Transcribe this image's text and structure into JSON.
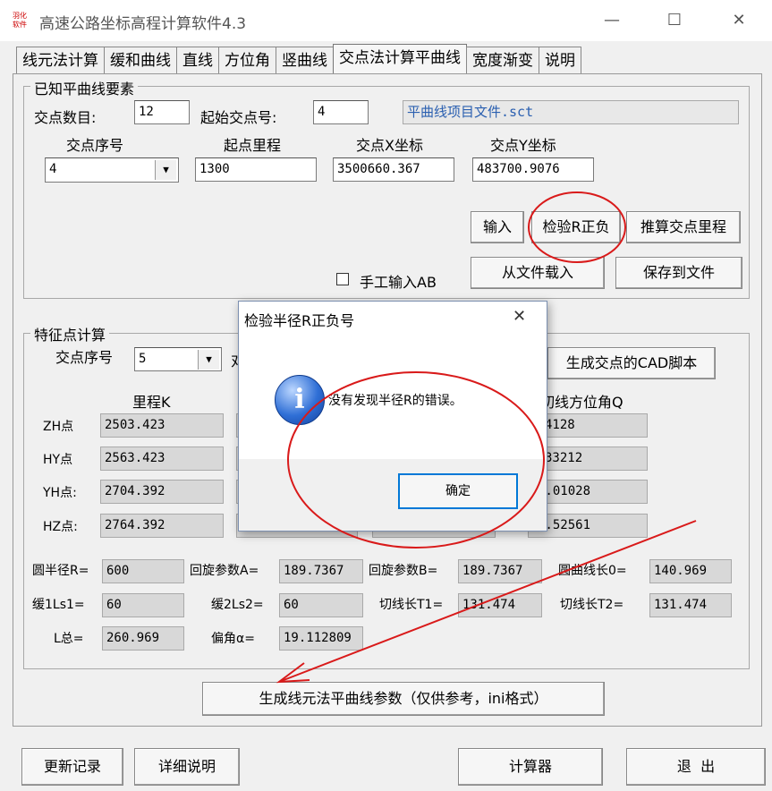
{
  "window": {
    "title": "高速公路坐标高程计算软件4.3",
    "icon_text": "羽化\n软件",
    "minimize_icon": "—",
    "maximize_icon": "☐",
    "close_icon": "✕"
  },
  "tabs": [
    {
      "label": "线元法计算",
      "active": false
    },
    {
      "label": "缓和曲线",
      "active": false
    },
    {
      "label": "直线",
      "active": false
    },
    {
      "label": "方位角",
      "active": false
    },
    {
      "label": "竖曲线",
      "active": false
    },
    {
      "label": "交点法计算平曲线",
      "active": true
    },
    {
      "label": "宽度渐变",
      "active": false
    },
    {
      "label": "说明",
      "active": false
    }
  ],
  "known": {
    "legend": "已知平曲线要素",
    "count_label": "交点数目:",
    "count_value": "12",
    "start_label": "起始交点号:",
    "start_value": "4",
    "file_name": "平曲线项目文件.sct",
    "col_index": "交点序号",
    "col_start_mileage": "起点里程",
    "col_x": "交点X坐标",
    "col_y": "交点Y坐标",
    "index_value": "4",
    "start_mileage_value": "1300",
    "x_value": "3500660.367",
    "y_value": "483700.9076",
    "btn_input": "输入",
    "btn_check_r": "检验R正负",
    "btn_calc_mileage": "推算交点里程",
    "manual_ab_label": "手工输入AB",
    "btn_load": "从文件载入",
    "btn_save": "保存到文件"
  },
  "feature": {
    "legend": "特征点计算",
    "index_label": "交点序号",
    "index_value": "5",
    "partial_label": "对",
    "btn_cad": "生成交点的CAD脚本",
    "col_mileage": "里程K",
    "col_azimuth": "切线方位角Q",
    "rows": [
      {
        "label": "ZH点",
        "mileage": "2503.423",
        "azimuth": "4128"
      },
      {
        "label": "HY点",
        "mileage": "2563.423",
        "azimuth": "33212"
      },
      {
        "label": "YH点:",
        "mileage": "2704.392",
        "azimuth": "4.01028"
      },
      {
        "label": "HZ点:",
        "mileage": "2764.392",
        "azimuth": "6.52561"
      }
    ],
    "params": {
      "radius_label": "圆半径R=",
      "radius_value": "600",
      "a_label": "回旋参数A=",
      "a_value": "189.7367",
      "b_label": "回旋参数B=",
      "b_value": "189.7367",
      "lo_label": "圆曲线长0=",
      "lo_value": "140.969",
      "ls1_label": "缓1Ls1=",
      "ls1_value": "60",
      "ls2_label": "缓2Ls2=",
      "ls2_value": "60",
      "t1_label": "切线长T1=",
      "t1_value": "131.474",
      "t2_label": "切线长T2=",
      "t2_value": "131.474",
      "ltotal_label": "L总=",
      "ltotal_value": "260.969",
      "alpha_label": "偏角α=",
      "alpha_value": "19.112809"
    },
    "btn_generate": "生成线元法平曲线参数（仅供参考，ini格式）"
  },
  "bottom": {
    "btn_log": "更新记录",
    "btn_detail": "详细说明",
    "btn_calc": "计算器",
    "btn_exit": "退  出"
  },
  "dialog": {
    "title": "检验半径R正负号",
    "close_icon": "✕",
    "icon_glyph": "i",
    "message": "没有发现半径R的错误。",
    "ok": "确定"
  },
  "colors": {
    "annotation_red": "#d91a1a",
    "file_text": "#2a5fb0"
  }
}
